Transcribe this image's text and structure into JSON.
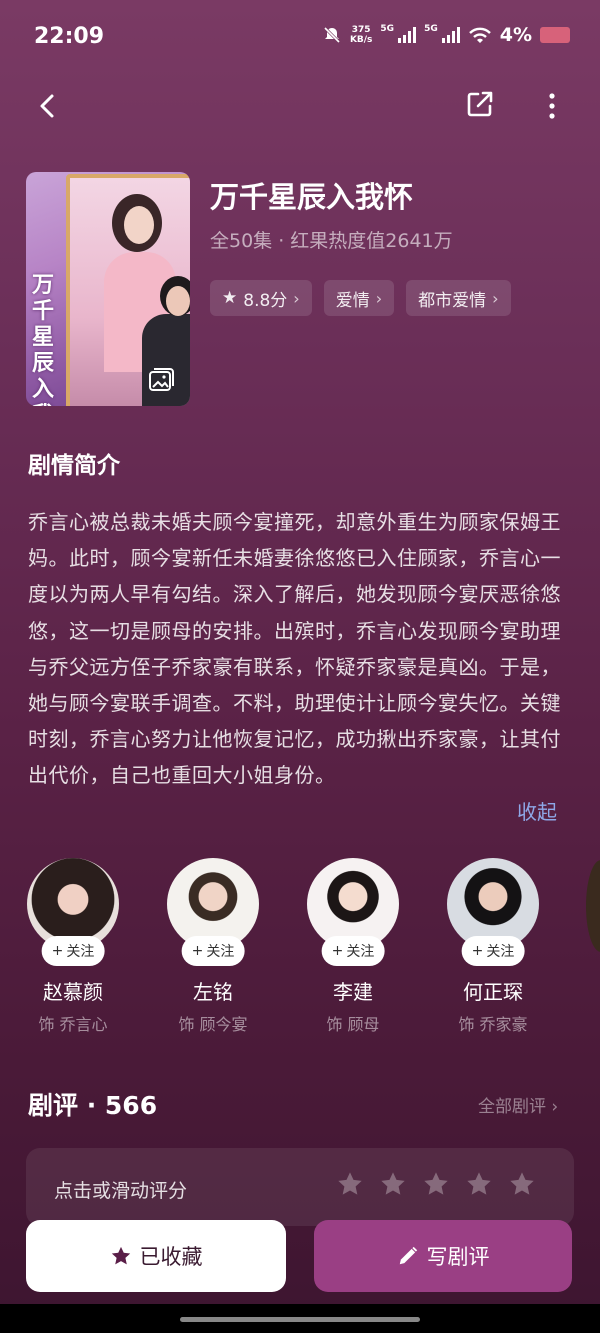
{
  "status_bar": {
    "time": "22:09",
    "net_speed_value": "375",
    "net_speed_unit": "KB/s",
    "sig1_label": "5G",
    "sig2_label": "5G",
    "battery": "4%"
  },
  "show": {
    "title": "万千星辰入我怀",
    "meta": "全50集 · 红果热度值2641万",
    "poster_title": "万千星辰入我怀",
    "tags": [
      "8.8分",
      "爱情",
      "都市爱情"
    ]
  },
  "synopsis": {
    "heading": "剧情简介",
    "text": "乔言心被总裁未婚夫顾今宴撞死，却意外重生为顾家保姆王妈。此时，顾今宴新任未婚妻徐悠悠已入住顾家，乔言心一度以为两人早有勾结。深入了解后，她发现顾今宴厌恶徐悠悠，这一切是顾母的安排。出殡时，乔言心发现顾今宴助理与乔父远方侄子乔家豪有联系，怀疑乔家豪是真凶。于是，她与顾今宴联手调查。不料，助理使计让顾今宴失忆。关键时刻，乔言心努力让他恢复记忆，成功揪出乔家豪，让其付出代价，自己也重回大小姐身份。",
    "collapse_label": "收起"
  },
  "cast": [
    {
      "name": "赵慕颜",
      "role": "饰 乔言心",
      "follow": "关注"
    },
    {
      "name": "左铭",
      "role": "饰 顾今宴",
      "follow": "关注"
    },
    {
      "name": "李建",
      "role": "饰 顾母",
      "follow": "关注"
    },
    {
      "name": "何正琛",
      "role": "饰 乔家豪",
      "follow": "关注"
    }
  ],
  "reviews": {
    "title": "剧评 · 566",
    "all_label": "全部剧评",
    "rating_prompt": "点击或滑动评分"
  },
  "actions": {
    "collected_label": "已收藏",
    "write_review_label": "写剧评"
  }
}
